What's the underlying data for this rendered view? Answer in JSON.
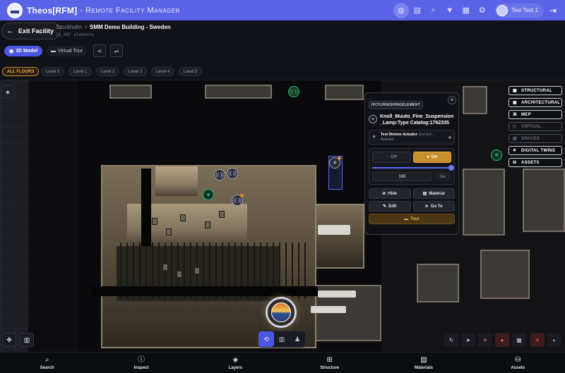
{
  "app": {
    "title": "Theos[RFM]",
    "subtitle": "- Remote Facility Manager"
  },
  "topbar": {
    "user_name": "Test Test 1",
    "icons": [
      "globe-icon",
      "folder-icon",
      "search-icon",
      "filter-icon",
      "layers-icon",
      "gear-icon"
    ]
  },
  "header": {
    "exit_label": "Exit Facility",
    "breadcrumb_city": "Stockholm",
    "breadcrumb_sep": ">",
    "building_name": "SMM Demo Building - Sweden",
    "elements_count": "11,987 elements"
  },
  "modes": {
    "model_3d": "3D Model",
    "virtual_tour": "Virtual Tour"
  },
  "floors": [
    "ALL FLOORS",
    "Level 0",
    "Level 1",
    "Level 2",
    "Level 3",
    "Level 4",
    "Level 5"
  ],
  "layers": [
    {
      "label": "STRUCTURAL",
      "on": true
    },
    {
      "label": "ARCHITECTURAL",
      "on": true
    },
    {
      "label": "MEP",
      "on": true
    },
    {
      "label": "VIRTUAL",
      "on": false
    },
    {
      "label": "SPACES",
      "on": false
    },
    {
      "label": "DIGITAL TWINS",
      "on": true
    },
    {
      "label": "ASSETS",
      "on": true
    }
  ],
  "info_panel": {
    "type_chip": "IFCFURNISHINGELEMENT",
    "element_name": "Knoll_Muuto_Fine_Suspension_Lamp:Type Catalog:1762335",
    "actuator_title": "Test Dimmer Actuator",
    "actuator_id": "(test-ach...",
    "actuator_type": "Actuator",
    "off_label": "Off",
    "on_label": "On",
    "dim_level": 100,
    "dim_value": "100",
    "set_label": "Set",
    "hide_label": "Hide",
    "material_label": "Material",
    "edit_label": "Edit",
    "goto_label": "Go To",
    "tour_label": "Tour"
  },
  "bottom_nav": [
    {
      "label": "Search",
      "icon": "search-icon"
    },
    {
      "label": "Inspect",
      "icon": "info-icon"
    },
    {
      "label": "Layers",
      "icon": "layers-icon"
    },
    {
      "label": "Structure",
      "icon": "structure-icon"
    },
    {
      "label": "Materials",
      "icon": "materials-icon"
    },
    {
      "label": "Assets",
      "icon": "assets-icon"
    }
  ],
  "colors": {
    "primary": "#5a63e6",
    "accent_orange": "#c8902c",
    "twin_green": "#25c06a"
  }
}
